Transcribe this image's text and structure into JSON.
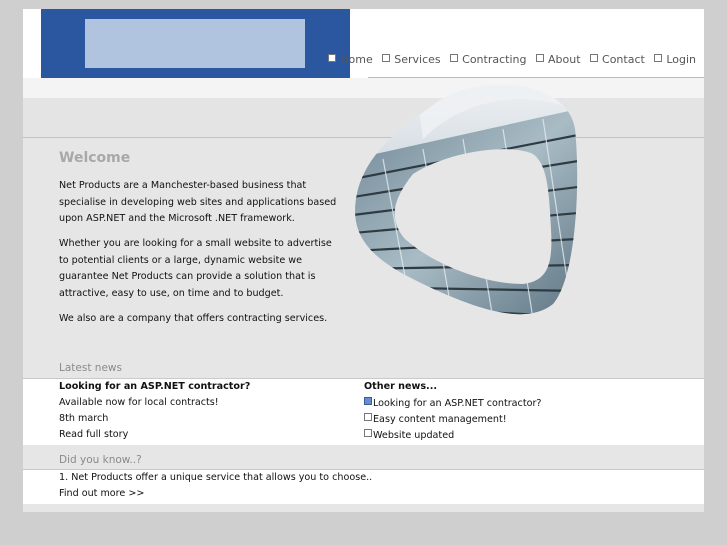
{
  "nav": {
    "items": [
      {
        "label": "Home"
      },
      {
        "label": "Services"
      },
      {
        "label": "Contracting"
      },
      {
        "label": "About"
      },
      {
        "label": "Contact"
      },
      {
        "label": "Login"
      }
    ]
  },
  "welcome": {
    "title": "Welcome",
    "paragraphs": [
      "Net Products are a Manchester-based business that specialise in developing web sites and applications based upon ASP.NET and the Microsoft .NET framework.",
      "Whether you are looking for a small website to advertise to potential clients or a large, dynamic website we guarantee Net Products can provide a solution that is attractive, easy to use, on time and to budget.",
      "We also are a company that offers contracting services."
    ]
  },
  "latest_news": {
    "title": "Latest news",
    "headline": "Looking for an ASP.NET contractor?",
    "summary": "Available now for local contracts!",
    "date": "8th march",
    "read_more": "Read full story"
  },
  "other_news": {
    "title": "Other news...",
    "items": [
      {
        "label": "Looking for an ASP.NET contractor?"
      },
      {
        "label": "Easy content management!"
      },
      {
        "label": "Website updated"
      }
    ]
  },
  "did_you_know": {
    "title": "Did you know..?",
    "text": "1. Net Products offer a unique service that allows you to choose..",
    "more": "Find out more >>"
  },
  "colors": {
    "brand_blue": "#2b56a0",
    "logo_panel": "#b0c4df"
  }
}
